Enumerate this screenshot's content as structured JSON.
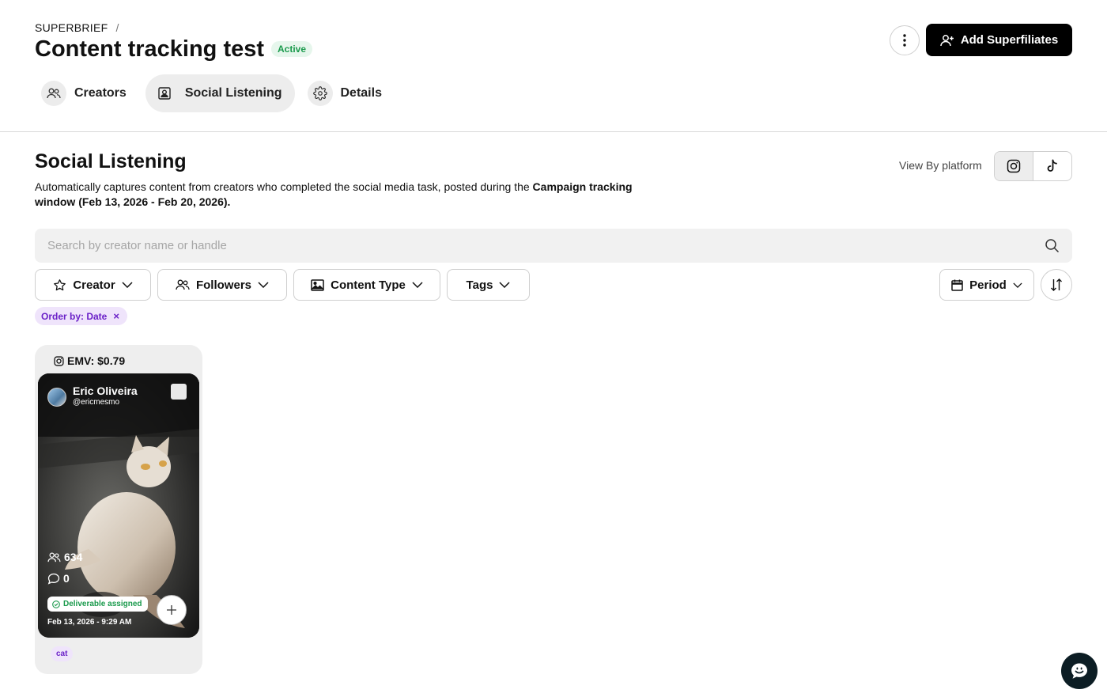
{
  "header": {
    "breadcrumb_root": "SUPERBRIEF",
    "breadcrumb_sep": "/",
    "title": "Content tracking test",
    "status": "Active",
    "add_button_label": "Add Superfiliates"
  },
  "tabs": [
    {
      "label": "Creators",
      "icon": "users-icon",
      "active": false
    },
    {
      "label": "Social Listening",
      "icon": "contact-card-icon",
      "active": true
    },
    {
      "label": "Details",
      "icon": "gear-icon",
      "active": false
    }
  ],
  "section": {
    "title": "Social Listening",
    "desc_pre": "Automatically captures content from creators who completed the social media task, posted during the ",
    "desc_bold": "Campaign tracking window (Feb 13, 2026 - Feb 20, 2026).",
    "view_by_label": "View By platform",
    "platforms": [
      "instagram-icon",
      "tiktok-icon"
    ],
    "selected_platform": "instagram"
  },
  "search": {
    "placeholder": "Search by creator name or handle",
    "value": ""
  },
  "filters": {
    "creator": "Creator",
    "followers": "Followers",
    "content_type": "Content Type",
    "tags": "Tags",
    "period": "Period"
  },
  "active_chip": {
    "label": "Order by: Date",
    "remove": "×"
  },
  "cards": [
    {
      "emv": "EMV: $0.79",
      "creator_name": "Eric Oliveira",
      "creator_handle": "@ericmesmo",
      "followers": "634",
      "comments": "0",
      "deliverable": "Deliverable assigned",
      "date": "Feb 13, 2026 - 9:29 AM",
      "tag": "cat"
    }
  ],
  "colors": {
    "accent_dark": "#000000",
    "active_green": "#1a9a4c",
    "tag_purple": "#6b21c8",
    "chat_bubble": "#0c1d24"
  }
}
